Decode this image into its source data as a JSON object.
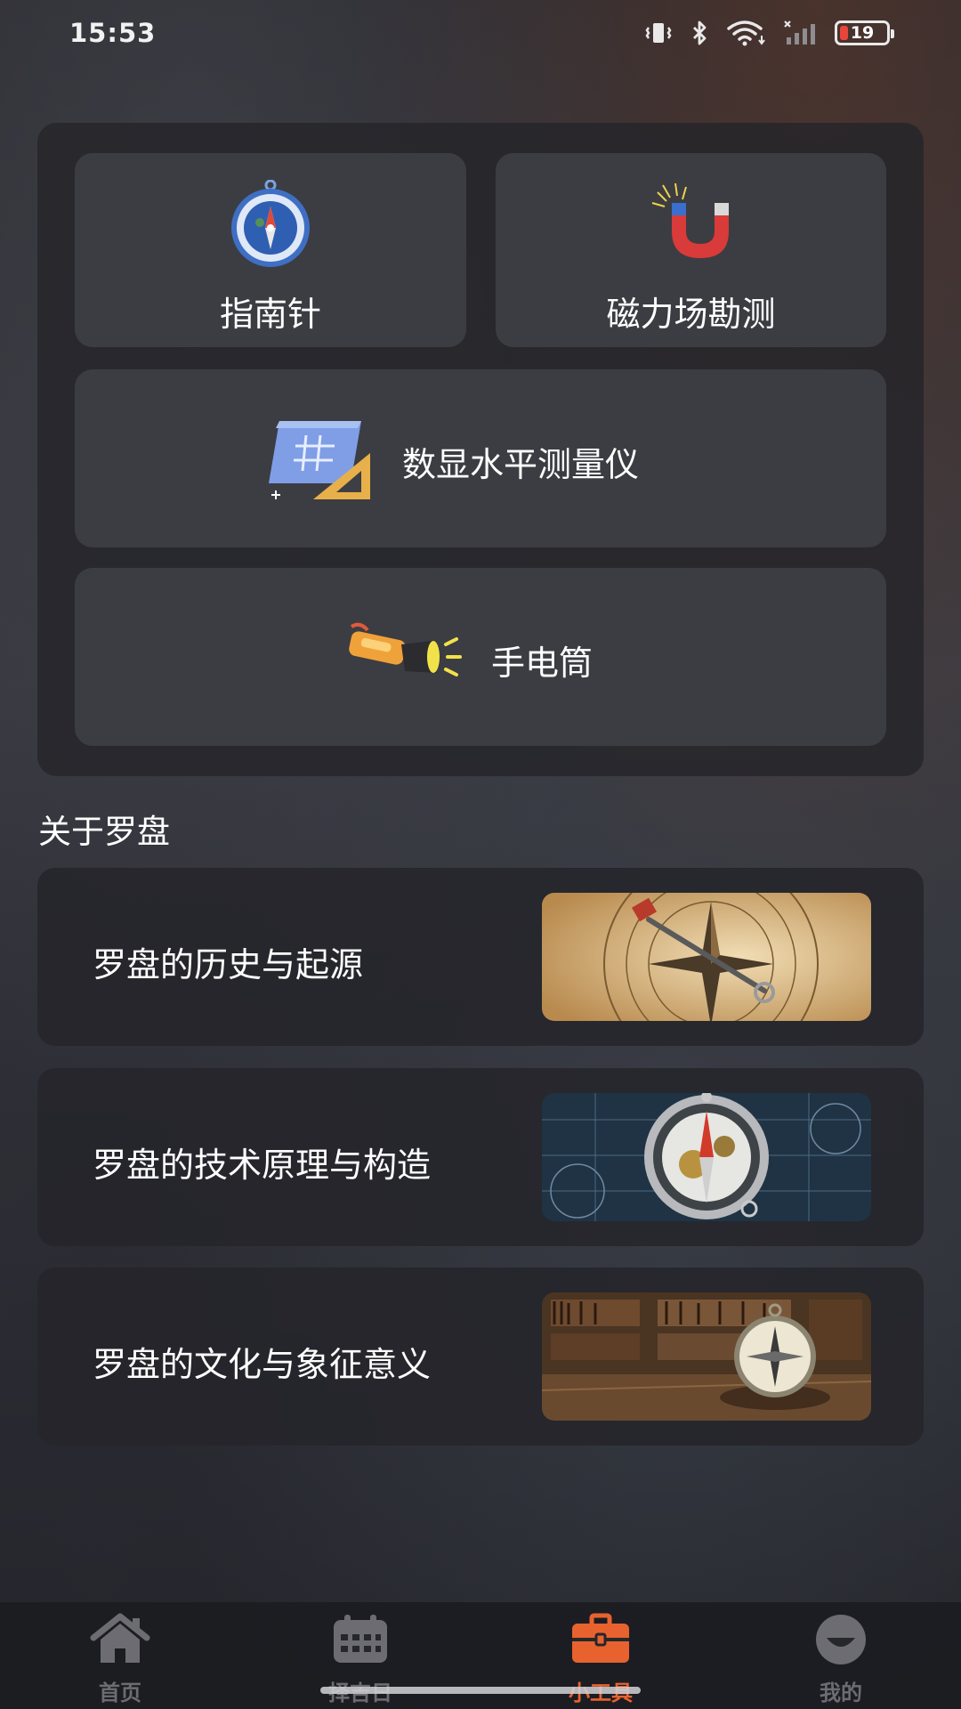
{
  "status_bar": {
    "time": "15:53",
    "battery_level": "19",
    "icons": [
      "vibrate-icon",
      "bluetooth-icon",
      "wifi-icon",
      "cellular-signal-icon",
      "battery-icon"
    ]
  },
  "tools": {
    "compass": {
      "label": "指南针",
      "icon": "compass-icon"
    },
    "magnetic_field": {
      "label": "磁力场勘测",
      "icon": "magnet-icon"
    },
    "digital_level": {
      "label": "数显水平测量仪",
      "icon": "blueprint-ruler-icon"
    },
    "flashlight": {
      "label": "手电筒",
      "icon": "flashlight-icon"
    }
  },
  "about": {
    "title": "关于罗盘",
    "articles": [
      {
        "title": "罗盘的历史与起源",
        "image": "antique-compass-rose-image"
      },
      {
        "title": "罗盘的技术原理与构造",
        "image": "mechanical-compass-blueprint-image"
      },
      {
        "title": "罗盘的文化与象征意义",
        "image": "compass-library-desk-image"
      }
    ]
  },
  "bottom_nav": {
    "items": [
      {
        "label": "首页",
        "icon": "home-icon",
        "active": false
      },
      {
        "label": "择吉日",
        "icon": "calendar-icon",
        "active": false
      },
      {
        "label": "小工具",
        "icon": "toolbox-icon",
        "active": true
      },
      {
        "label": "我的",
        "icon": "profile-icon",
        "active": false
      }
    ]
  },
  "colors": {
    "accent": "#e8622f",
    "card_background": "#3e3f44",
    "panel_background": "#24252a",
    "inactive_nav": "#6c6c72"
  }
}
